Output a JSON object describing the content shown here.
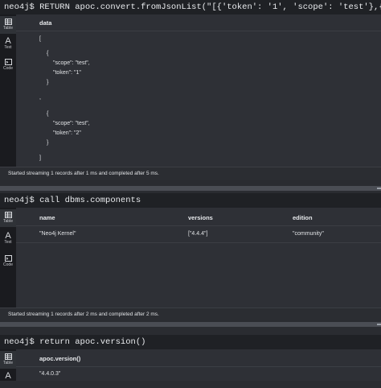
{
  "frames": [
    {
      "command": "neo4j$ RETURN apoc.convert.fromJsonList(\"[{'token': '1', 'scope': 'test'},{'token': '2','scope': 'te",
      "sidebar": [
        {
          "label": "Table",
          "icon": "table-icon"
        },
        {
          "label": "Text",
          "icon": "text-icon"
        },
        {
          "label": "Code",
          "icon": "code-icon"
        }
      ],
      "column": "data",
      "json_lines": [
        "[",
        "{",
        "\"scope\": \"test\",",
        "\"token\": \"1\"",
        "}",
        ",",
        "{",
        "\"scope\": \"test\",",
        "\"token\": \"2\"",
        "}",
        "]"
      ],
      "status": "Started streaming 1 records after 1 ms and completed after 5 ms."
    },
    {
      "command": "neo4j$ call dbms.components",
      "sidebar": [
        {
          "label": "Table",
          "icon": "table-icon"
        },
        {
          "label": "Text",
          "icon": "text-icon"
        },
        {
          "label": "Code",
          "icon": "code-icon"
        }
      ],
      "columns": [
        "name",
        "versions",
        "edition"
      ],
      "row": [
        "\"Neo4j Kernel\"",
        "[\"4.4.4\"]",
        "\"community\""
      ],
      "status": "Started streaming 1 records after 2 ms and completed after 2 ms."
    },
    {
      "command": "neo4j$ return apoc.version()",
      "sidebar": [
        {
          "label": "Table",
          "icon": "table-icon"
        },
        {
          "label": "Text",
          "icon": "text-icon"
        }
      ],
      "column": "apoc.version()",
      "row": [
        "\"4.4.0.3\""
      ]
    }
  ]
}
